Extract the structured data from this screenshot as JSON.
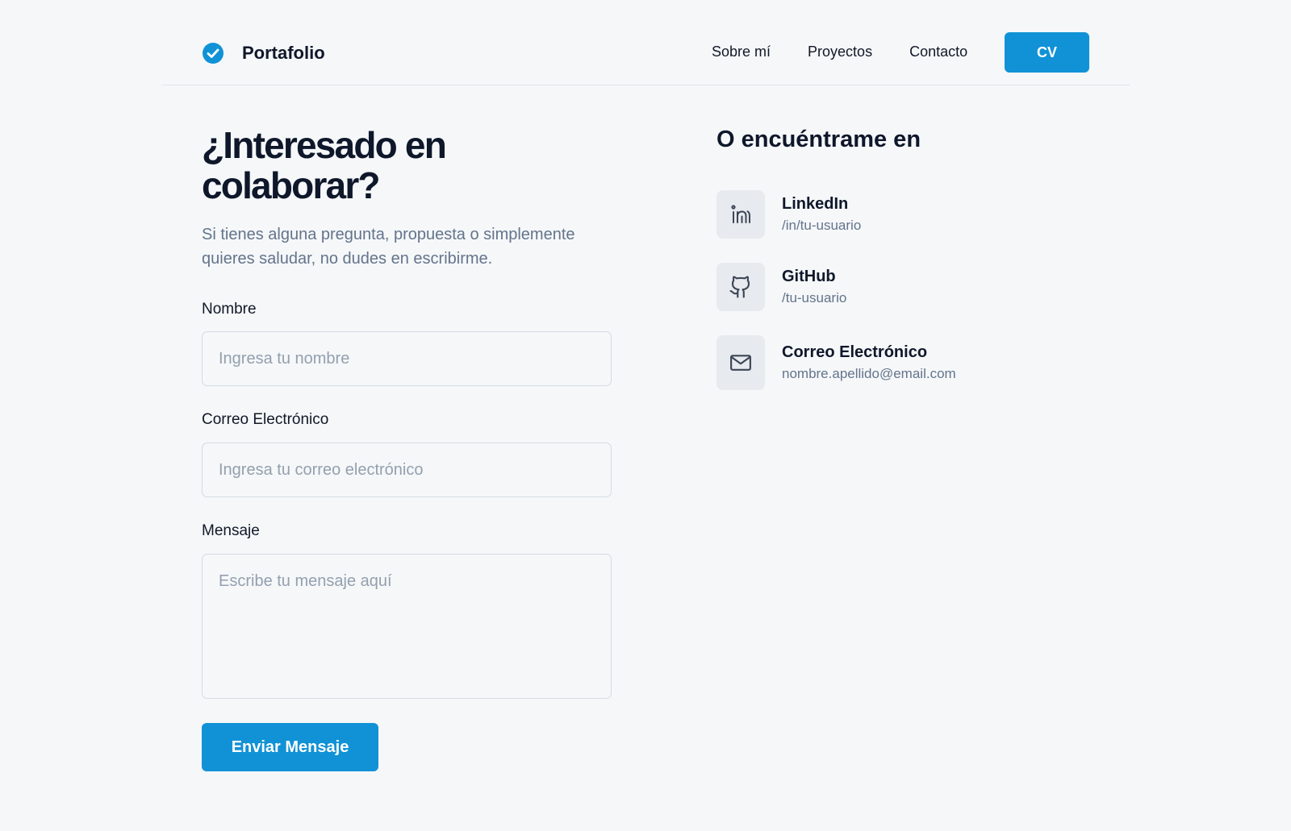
{
  "header": {
    "brand": "Portafolio",
    "nav": [
      "Sobre mí",
      "Proyectos",
      "Contacto"
    ],
    "cv_label": "CV"
  },
  "form": {
    "title": "¿Interesado en colaborar?",
    "subtitle": "Si tienes alguna pregunta, propuesta o simplemente quieres saludar, no dudes en escribirme.",
    "name_label": "Nombre",
    "name_placeholder": "Ingresa tu nombre",
    "email_label": "Correo Electrónico",
    "email_placeholder": "Ingresa tu correo electrónico",
    "message_label": "Mensaje",
    "message_placeholder": "Escribe tu mensaje aquí",
    "submit_label": "Enviar Mensaje"
  },
  "contact": {
    "title": "O encuéntrame en",
    "items": [
      {
        "name": "LinkedIn",
        "value": "/in/tu-usuario",
        "icon": "linkedin-icon"
      },
      {
        "name": "GitHub",
        "value": "/tu-usuario",
        "icon": "github-icon"
      },
      {
        "name": "Correo Electrónico",
        "value": "nombre.apellido@email.com",
        "icon": "mail-icon"
      }
    ]
  },
  "colors": {
    "accent": "#1192d6",
    "background": "#f5f7f9",
    "heading": "#0f172a",
    "muted": "#64748b"
  }
}
